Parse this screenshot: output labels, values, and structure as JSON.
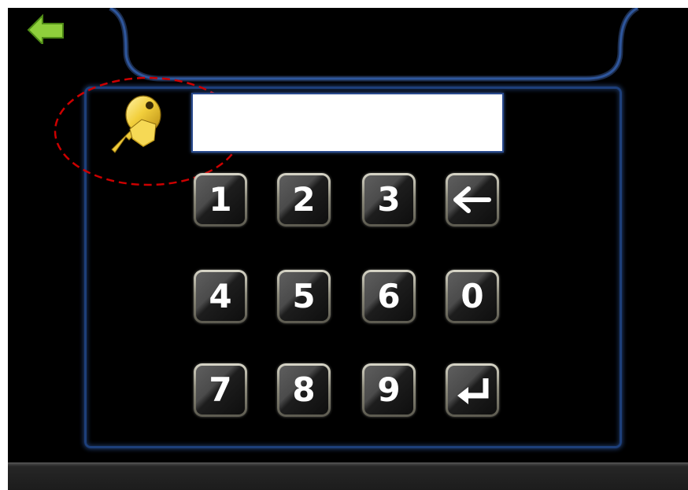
{
  "pin_entry": {
    "value": "",
    "placeholder": ""
  },
  "keypad": {
    "keys": [
      {
        "label": "1",
        "icon": ""
      },
      {
        "label": "2",
        "icon": ""
      },
      {
        "label": "3",
        "icon": ""
      },
      {
        "label": "",
        "icon": "backspace-arrow-icon"
      },
      {
        "label": "4",
        "icon": ""
      },
      {
        "label": "5",
        "icon": ""
      },
      {
        "label": "6",
        "icon": ""
      },
      {
        "label": "0",
        "icon": ""
      },
      {
        "label": "7",
        "icon": ""
      },
      {
        "label": "8",
        "icon": ""
      },
      {
        "label": "9",
        "icon": ""
      },
      {
        "label": "",
        "icon": "enter-return-icon"
      }
    ]
  },
  "icons": {
    "key": "key-icon",
    "back": "back-arrow-icon"
  },
  "colors": {
    "screen_background": "#000000",
    "panel_border": "#1d3f7a",
    "annotation_circle": "#cc0000",
    "key_icon": "#e8c23a",
    "back_icon": "#8fcf3c"
  }
}
